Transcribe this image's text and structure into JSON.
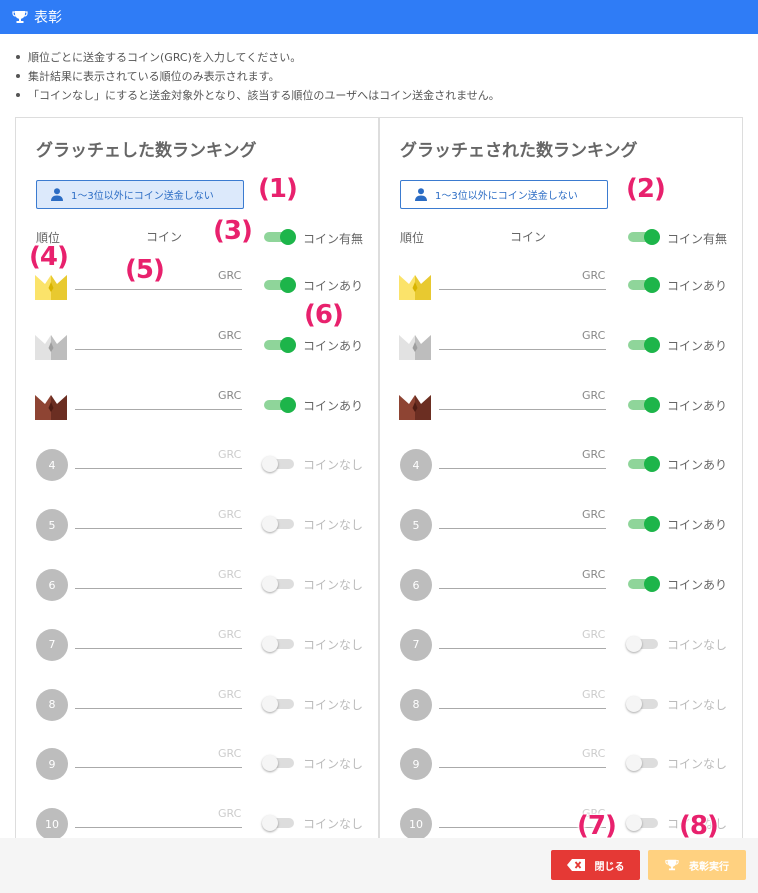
{
  "header": {
    "title": "表彰",
    "icon": "trophy-icon"
  },
  "notes": [
    "順位ごとに送金するコイン(GRC)を入力してください。",
    "集計結果に表示されている順位のみ表示されます。",
    "「コインなし」にすると送金対象外となり、該当する順位のユーザへはコイン送金されません。"
  ],
  "left_panel": {
    "title": "グラッチェした数ランキング",
    "rank_button": "1〜3位以外にコイン送金しない",
    "header_rank": "順位",
    "header_coin": "コイン",
    "master_toggle": {
      "on": true,
      "label": "コイン有無"
    },
    "rows": [
      {
        "rank": "1",
        "unit": "GRC",
        "on": true,
        "label": "コインあり"
      },
      {
        "rank": "2",
        "unit": "GRC",
        "on": true,
        "label": "コインあり"
      },
      {
        "rank": "3",
        "unit": "GRC",
        "on": true,
        "label": "コインあり"
      },
      {
        "rank": "4",
        "unit": "GRC",
        "on": false,
        "label": "コインなし"
      },
      {
        "rank": "5",
        "unit": "GRC",
        "on": false,
        "label": "コインなし"
      },
      {
        "rank": "6",
        "unit": "GRC",
        "on": false,
        "label": "コインなし"
      },
      {
        "rank": "7",
        "unit": "GRC",
        "on": false,
        "label": "コインなし"
      },
      {
        "rank": "8",
        "unit": "GRC",
        "on": false,
        "label": "コインなし"
      },
      {
        "rank": "9",
        "unit": "GRC",
        "on": false,
        "label": "コインなし"
      },
      {
        "rank": "10",
        "unit": "GRC",
        "on": false,
        "label": "コインなし"
      }
    ]
  },
  "right_panel": {
    "title": "グラッチェされた数ランキング",
    "rank_button": "1〜3位以外にコイン送金しない",
    "header_rank": "順位",
    "header_coin": "コイン",
    "master_toggle": {
      "on": true,
      "label": "コイン有無"
    },
    "rows": [
      {
        "rank": "1",
        "unit": "GRC",
        "on": true,
        "label": "コインあり"
      },
      {
        "rank": "2",
        "unit": "GRC",
        "on": true,
        "label": "コインあり"
      },
      {
        "rank": "3",
        "unit": "GRC",
        "on": true,
        "label": "コインあり"
      },
      {
        "rank": "4",
        "unit": "GRC",
        "on": true,
        "label": "コインあり"
      },
      {
        "rank": "5",
        "unit": "GRC",
        "on": true,
        "label": "コインあり"
      },
      {
        "rank": "6",
        "unit": "GRC",
        "on": true,
        "label": "コインあり"
      },
      {
        "rank": "7",
        "unit": "GRC",
        "on": false,
        "label": "コインなし"
      },
      {
        "rank": "8",
        "unit": "GRC",
        "on": false,
        "label": "コインなし"
      },
      {
        "rank": "9",
        "unit": "GRC",
        "on": false,
        "label": "コインなし"
      },
      {
        "rank": "10",
        "unit": "GRC",
        "on": false,
        "label": "コインなし"
      }
    ]
  },
  "footer": {
    "close_label": "閉じる",
    "execute_label": "表彰実行"
  },
  "annotations": {
    "a1": "(1)",
    "a2": "(2)",
    "a3": "(3)",
    "a4": "(4)",
    "a5": "(5)",
    "a6": "(6)",
    "a7": "(7)",
    "a8": "(8)"
  },
  "colors": {
    "header_bg": "#2f7cf6",
    "toggle_on": "#1db54a",
    "close_btn": "#e53935",
    "execute_btn": "#ffd180",
    "annotation": "#e8216d",
    "gold": "#f9d923",
    "silver": "#c8c8c8",
    "bronze": "#8a3b2b"
  }
}
